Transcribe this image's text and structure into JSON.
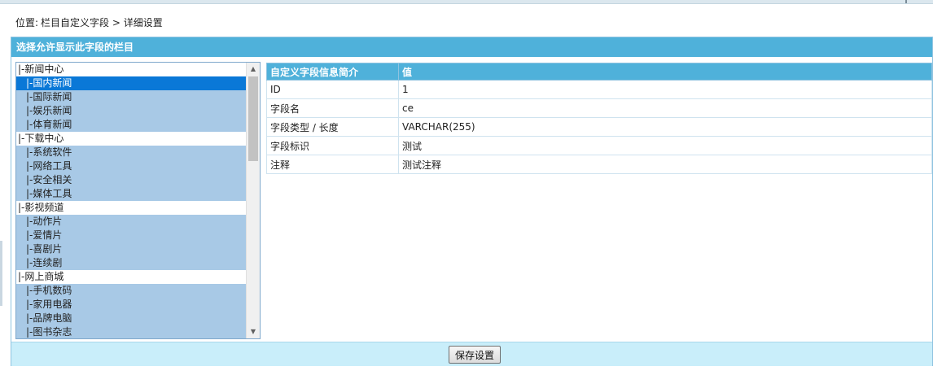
{
  "breadcrumb": {
    "label": "位置:",
    "path": "栏目自定义字段 > 详细设置"
  },
  "panel": {
    "title": "选择允许显示此字段的栏目"
  },
  "column_list": {
    "items": [
      {
        "label": "|-新闻中心",
        "level": 0,
        "selected": false
      },
      {
        "label": "|-国内新闻",
        "level": 1,
        "selected": true
      },
      {
        "label": "|-国际新闻",
        "level": 1,
        "selected": false
      },
      {
        "label": "|-娱乐新闻",
        "level": 1,
        "selected": false
      },
      {
        "label": "|-体育新闻",
        "level": 1,
        "selected": false
      },
      {
        "label": "|-下载中心",
        "level": 0,
        "selected": false
      },
      {
        "label": "|-系统软件",
        "level": 1,
        "selected": false
      },
      {
        "label": "|-网络工具",
        "level": 1,
        "selected": false
      },
      {
        "label": "|-安全相关",
        "level": 1,
        "selected": false
      },
      {
        "label": "|-媒体工具",
        "level": 1,
        "selected": false
      },
      {
        "label": "|-影视频道",
        "level": 0,
        "selected": false
      },
      {
        "label": "|-动作片",
        "level": 1,
        "selected": false
      },
      {
        "label": "|-爱情片",
        "level": 1,
        "selected": false
      },
      {
        "label": "|-喜剧片",
        "level": 1,
        "selected": false
      },
      {
        "label": "|-连续剧",
        "level": 1,
        "selected": false
      },
      {
        "label": "|-网上商城",
        "level": 0,
        "selected": false
      },
      {
        "label": "|-手机数码",
        "level": 1,
        "selected": false
      },
      {
        "label": "|-家用电器",
        "level": 1,
        "selected": false
      },
      {
        "label": "|-品牌电脑",
        "level": 1,
        "selected": false
      },
      {
        "label": "|-图书杂志",
        "level": 1,
        "selected": false
      }
    ]
  },
  "info_table": {
    "headers": [
      "自定义字段信息简介",
      "值"
    ],
    "rows": [
      [
        "ID",
        "1"
      ],
      [
        "字段名",
        "ce"
      ],
      [
        "字段类型 / 长度",
        "VARCHAR(255)"
      ],
      [
        "字段标识",
        "测试"
      ],
      [
        "注释",
        "测试注释"
      ]
    ]
  },
  "footer": {
    "save_label": "保存设置"
  },
  "icons": {
    "scroll_up": "scroll-up-arrow-icon",
    "scroll_down": "scroll-down-arrow-icon"
  },
  "colors": {
    "header_blue": "#4fb1da",
    "selected_item": "#0a78d7",
    "sub_item": "#a8c9e6",
    "footer_bg": "#c9eefa"
  }
}
